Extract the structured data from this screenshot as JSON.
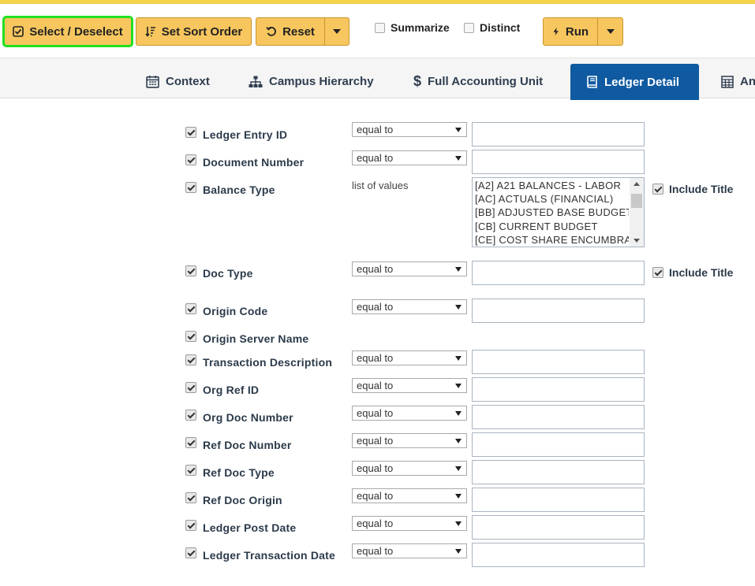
{
  "toolbar": {
    "select_deselect": "Select / Deselect",
    "set_sort_order": "Set Sort Order",
    "reset": "Reset",
    "summarize": "Summarize",
    "distinct": "Distinct",
    "run": "Run"
  },
  "tabs": [
    {
      "label": "Context",
      "icon": "calendar-icon"
    },
    {
      "label": "Campus Hierarchy",
      "icon": "hierarchy-icon"
    },
    {
      "label": "Full Accounting Unit",
      "icon": "dollar-icon"
    },
    {
      "label": "Ledger Detail",
      "icon": "book-icon",
      "active": true
    },
    {
      "label": "An",
      "icon": "calculator-icon"
    }
  ],
  "colors": {
    "accent": "#f7c65e",
    "active_tab": "#0f5aa0",
    "selected_outline": "#22e020"
  },
  "fields": [
    {
      "label": "Ledger Entry ID",
      "op": "equal to",
      "value": ""
    },
    {
      "label": "Document Number",
      "op": "equal to",
      "value": ""
    },
    {
      "label": "Balance Type",
      "op": "list of values",
      "include_title": "Include Title",
      "options": [
        "[A2] A21 BALANCES - LABOR",
        "[AC] ACTUALS (FINANCIAL)",
        "[BB] ADJUSTED BASE BUDGET",
        "[CB] CURRENT BUDGET",
        "[CE] COST SHARE ENCUMBRANCE"
      ]
    },
    {
      "label": "Doc Type",
      "op": "equal to",
      "value": "",
      "include_title": "Include Title"
    },
    {
      "label": "Origin Code",
      "op": "equal to",
      "value": ""
    },
    {
      "label": "Origin Server Name"
    },
    {
      "label": "Transaction Description",
      "op": "equal to",
      "value": ""
    },
    {
      "label": "Org Ref ID",
      "op": "equal to",
      "value": ""
    },
    {
      "label": "Org Doc Number",
      "op": "equal to",
      "value": ""
    },
    {
      "label": "Ref Doc Number",
      "op": "equal to",
      "value": ""
    },
    {
      "label": "Ref Doc Type",
      "op": "equal to",
      "value": ""
    },
    {
      "label": "Ref Doc Origin",
      "op": "equal to",
      "value": ""
    },
    {
      "label": "Ledger Post Date",
      "op": "equal to",
      "value": ""
    },
    {
      "label": "Ledger Transaction Date",
      "op": "equal to",
      "value": ""
    }
  ]
}
